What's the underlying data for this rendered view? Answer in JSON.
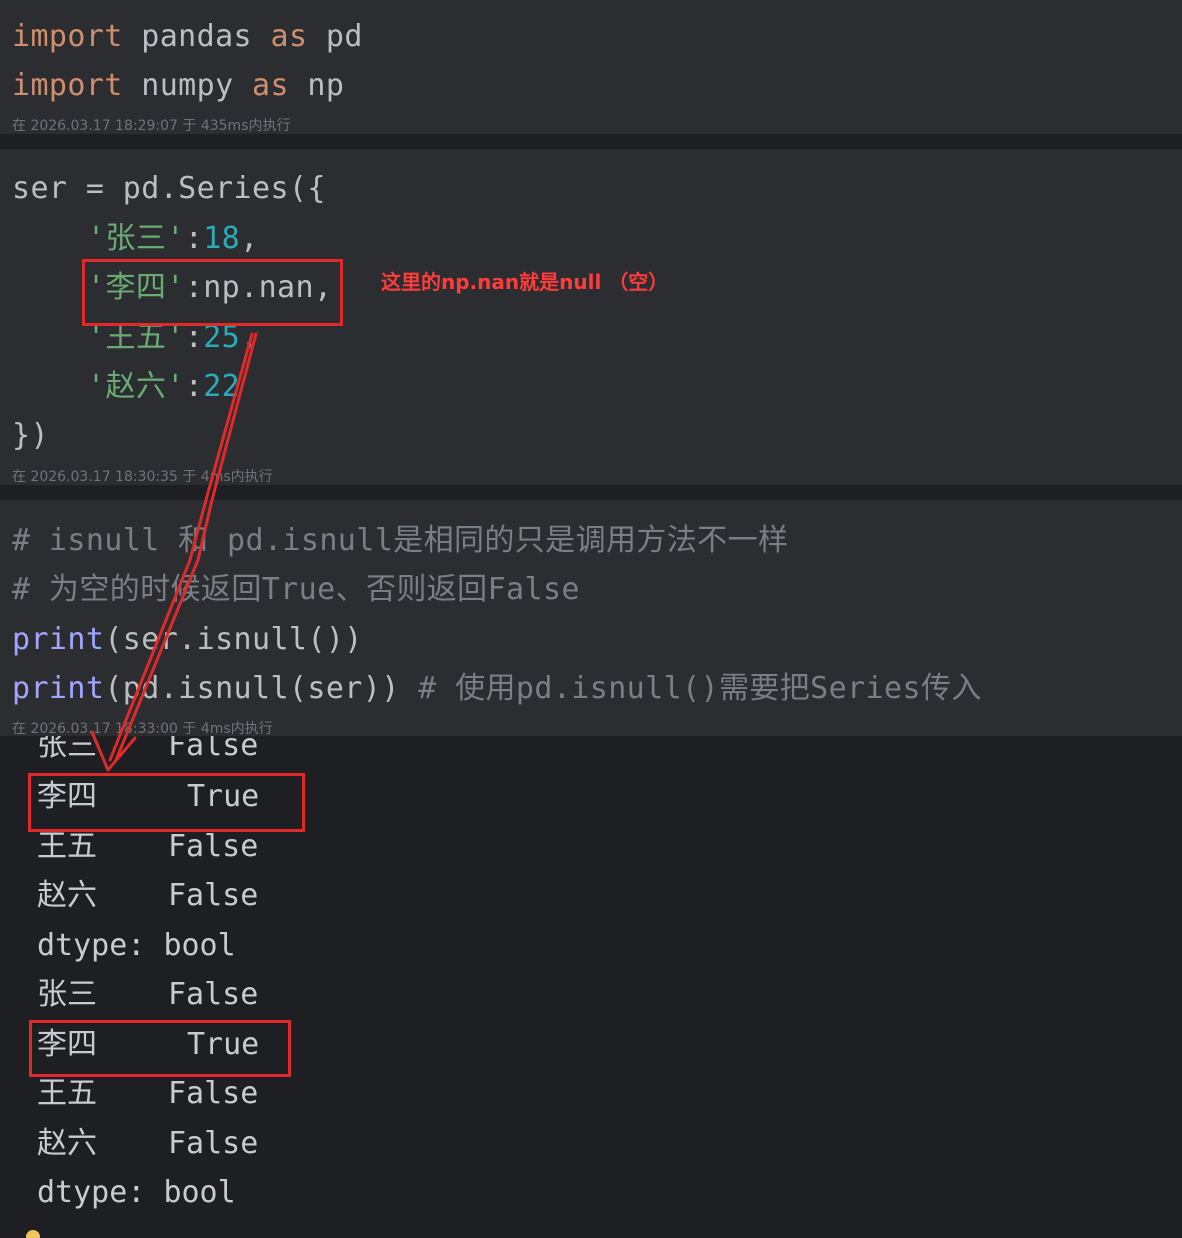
{
  "cell1": {
    "line1": {
      "kw1": "import",
      "mod": " pandas ",
      "kw2": "as",
      "alias": " pd"
    },
    "line2": {
      "kw1": "import",
      "mod": " numpy ",
      "kw2": "as",
      "alias": " np"
    },
    "meta": "在 2026.03.17 18:29:07 于 435ms内执行"
  },
  "cell2": {
    "line1": "ser = pd.Series({",
    "rows": [
      {
        "key": "'张三'",
        "sep": ":",
        "val": "18",
        "tail": ","
      },
      {
        "key": "'李四'",
        "sep": ":",
        "val": "np.nan",
        "tail": ","
      },
      {
        "key": "'王五'",
        "sep": ":",
        "val": "25",
        "tail": ","
      },
      {
        "key": "'赵六'",
        "sep": ":",
        "val": "22",
        "tail": ""
      }
    ],
    "close": "})",
    "meta": "在 2026.03.17 18:30:35 于 4ms内执行"
  },
  "annotation": "这里的np.nan就是null （空）",
  "cell3": {
    "comment1": "# isnull 和 pd.isnull是相同的只是调用方法不一样",
    "comment2": "# 为空的时候返回True、否则返回False",
    "print1": {
      "fn": "print",
      "args": "(ser.isnull())"
    },
    "print2": {
      "fn": "print",
      "args": "(pd.isnull(ser)) ",
      "comment": "# 使用pd.isnull()需要把Series传入"
    },
    "meta": "在 2026.03.17 18:33:00 于 4ms内执行"
  },
  "output": {
    "partial": {
      "label": "张三",
      "value": "False"
    },
    "rows": [
      {
        "label": "李四",
        "value": "True"
      },
      {
        "label": "王五",
        "value": "False"
      },
      {
        "label": "赵六",
        "value": "False"
      },
      {
        "label": "dtype:",
        "value": "bool"
      },
      {
        "label": "张三",
        "value": "False"
      },
      {
        "label": "李四",
        "value": "True"
      },
      {
        "label": "王五",
        "value": "False"
      },
      {
        "label": "赵六",
        "value": "False"
      },
      {
        "label": "dtype:",
        "value": "bool"
      }
    ]
  },
  "colors": {
    "keyword": "#cf8e6d",
    "function": "#a0a6ff",
    "string": "#6aab73",
    "number": "#2aacb8",
    "comment": "#7a7e85",
    "highlight": "#e02a2a"
  }
}
